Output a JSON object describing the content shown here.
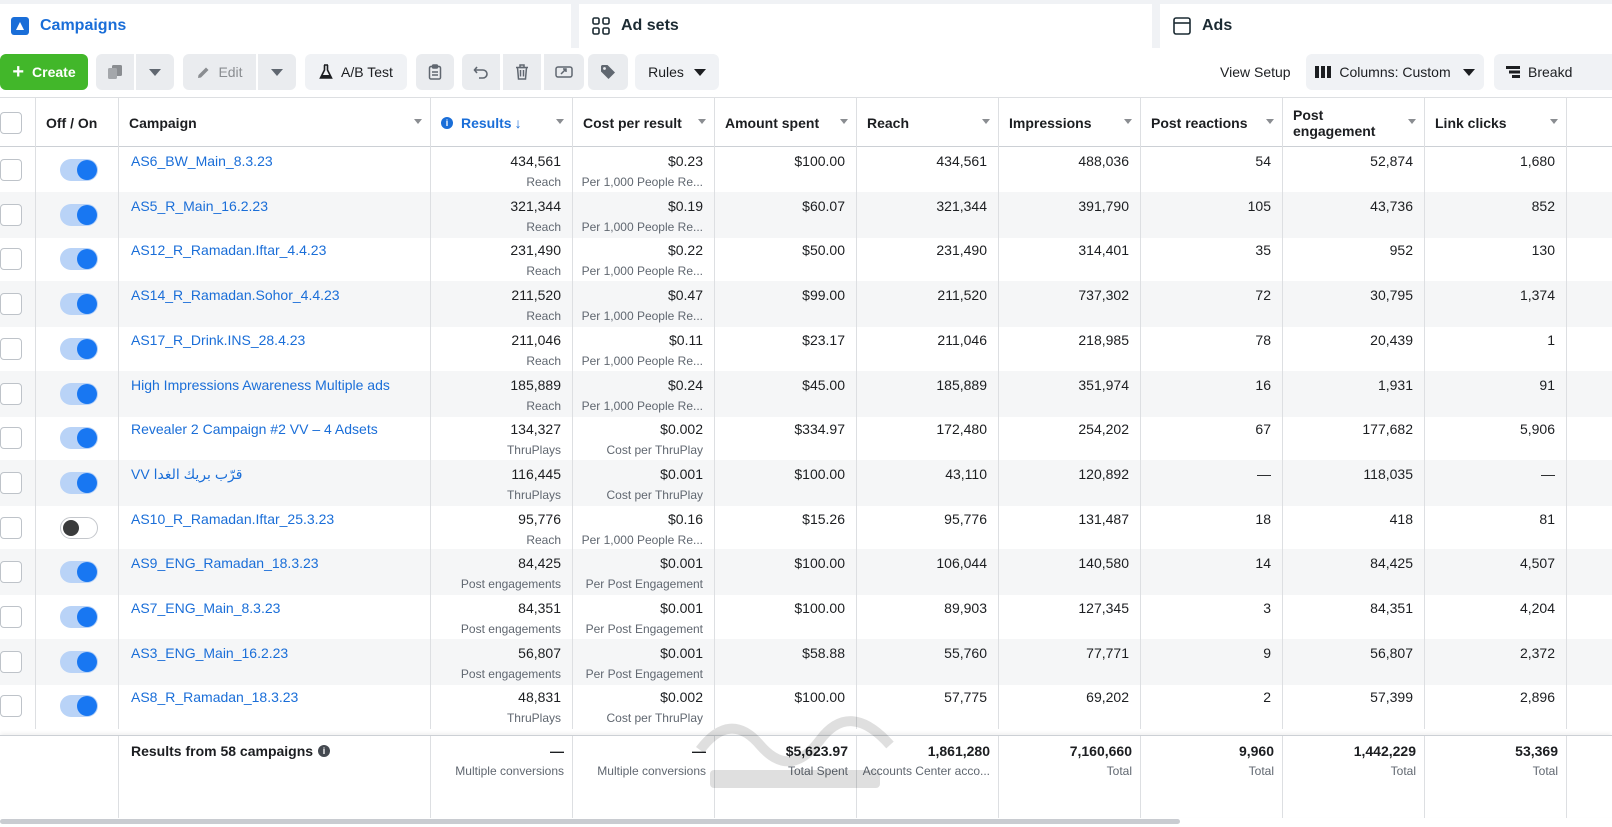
{
  "tabs": [
    {
      "label": "Campaigns",
      "icon": "campaigns-folder-icon"
    },
    {
      "label": "Ad sets",
      "icon": "ad-sets-grid-icon"
    },
    {
      "label": "Ads",
      "icon": "ads-window-icon"
    }
  ],
  "toolbar": {
    "create_label": "Create",
    "edit_label": "Edit",
    "ab_test_label": "A/B Test",
    "rules_label": "Rules",
    "view_setup_label": "View Setup",
    "columns_label": "Columns: Custom",
    "breakdown_label": "Breakd"
  },
  "columns": {
    "off_on": "Off / On",
    "campaign": "Campaign",
    "results": "Results",
    "cost_per_result": "Cost per result",
    "amount_spent": "Amount spent",
    "reach": "Reach",
    "impressions": "Impressions",
    "post_reactions": "Post reactions",
    "post_engagement_1": "Post",
    "post_engagement_2": "engagement",
    "link_clicks": "Link clicks"
  },
  "rows": [
    {
      "on": true,
      "name": "AS6_BW_Main_8.3.23",
      "results": "434,561",
      "results_sub": "Reach",
      "cost": "$0.23",
      "cost_sub": "Per 1,000 People Re...",
      "spent": "$100.00",
      "reach": "434,561",
      "impressions": "488,036",
      "reactions": "54",
      "engagement": "52,874",
      "clicks": "1,680"
    },
    {
      "on": true,
      "name": "AS5_R_Main_16.2.23",
      "results": "321,344",
      "results_sub": "Reach",
      "cost": "$0.19",
      "cost_sub": "Per 1,000 People Re...",
      "spent": "$60.07",
      "reach": "321,344",
      "impressions": "391,790",
      "reactions": "105",
      "engagement": "43,736",
      "clicks": "852"
    },
    {
      "on": true,
      "name": "AS12_R_Ramadan.Iftar_4.4.23",
      "results": "231,490",
      "results_sub": "Reach",
      "cost": "$0.22",
      "cost_sub": "Per 1,000 People Re...",
      "spent": "$50.00",
      "reach": "231,490",
      "impressions": "314,401",
      "reactions": "35",
      "engagement": "952",
      "clicks": "130"
    },
    {
      "on": true,
      "name": "AS14_R_Ramadan.Sohor_4.4.23",
      "results": "211,520",
      "results_sub": "Reach",
      "cost": "$0.47",
      "cost_sub": "Per 1,000 People Re...",
      "spent": "$99.00",
      "reach": "211,520",
      "impressions": "737,302",
      "reactions": "72",
      "engagement": "30,795",
      "clicks": "1,374"
    },
    {
      "on": true,
      "name": "AS17_R_Drink.INS_28.4.23",
      "results": "211,046",
      "results_sub": "Reach",
      "cost": "$0.11",
      "cost_sub": "Per 1,000 People Re...",
      "spent": "$23.17",
      "reach": "211,046",
      "impressions": "218,985",
      "reactions": "78",
      "engagement": "20,439",
      "clicks": "1"
    },
    {
      "on": true,
      "name": "High Impressions Awareness Multiple ads",
      "results": "185,889",
      "results_sub": "Reach",
      "cost": "$0.24",
      "cost_sub": "Per 1,000 People Re...",
      "spent": "$45.00",
      "reach": "185,889",
      "impressions": "351,974",
      "reactions": "16",
      "engagement": "1,931",
      "clicks": "91"
    },
    {
      "on": true,
      "name": "Revealer 2 Campaign #2 VV – 4 Adsets",
      "results": "134,327",
      "results_sub": "ThruPlays",
      "cost": "$0.002",
      "cost_sub": "Cost per ThruPlay",
      "spent": "$334.97",
      "reach": "172,480",
      "impressions": "254,202",
      "reactions": "67",
      "engagement": "177,682",
      "clicks": "5,906"
    },
    {
      "on": true,
      "name": "VV قرّب بريك الغدا",
      "results": "116,445",
      "results_sub": "ThruPlays",
      "cost": "$0.001",
      "cost_sub": "Cost per ThruPlay",
      "spent": "$100.00",
      "reach": "43,110",
      "impressions": "120,892",
      "reactions": "—",
      "engagement": "118,035",
      "clicks": "—"
    },
    {
      "on": false,
      "name": "AS10_R_Ramadan.Iftar_25.3.23",
      "results": "95,776",
      "results_sub": "Reach",
      "cost": "$0.16",
      "cost_sub": "Per 1,000 People Re...",
      "spent": "$15.26",
      "reach": "95,776",
      "impressions": "131,487",
      "reactions": "18",
      "engagement": "418",
      "clicks": "81"
    },
    {
      "on": true,
      "name": "AS9_ENG_Ramadan_18.3.23",
      "results": "84,425",
      "results_sub": "Post engagements",
      "cost": "$0.001",
      "cost_sub": "Per Post Engagement",
      "spent": "$100.00",
      "reach": "106,044",
      "impressions": "140,580",
      "reactions": "14",
      "engagement": "84,425",
      "clicks": "4,507"
    },
    {
      "on": true,
      "name": "AS7_ENG_Main_8.3.23",
      "results": "84,351",
      "results_sub": "Post engagements",
      "cost": "$0.001",
      "cost_sub": "Per Post Engagement",
      "spent": "$100.00",
      "reach": "89,903",
      "impressions": "127,345",
      "reactions": "3",
      "engagement": "84,351",
      "clicks": "4,204"
    },
    {
      "on": true,
      "name": "AS3_ENG_Main_16.2.23",
      "results": "56,807",
      "results_sub": "Post engagements",
      "cost": "$0.001",
      "cost_sub": "Per Post Engagement",
      "spent": "$58.88",
      "reach": "55,760",
      "impressions": "77,771",
      "reactions": "9",
      "engagement": "56,807",
      "clicks": "2,372"
    },
    {
      "on": true,
      "name": "AS8_R_Ramadan_18.3.23",
      "results": "48,831",
      "results_sub": "ThruPlays",
      "cost": "$0.002",
      "cost_sub": "Cost per ThruPlay",
      "spent": "$100.00",
      "reach": "57,775",
      "impressions": "69,202",
      "reactions": "2",
      "engagement": "57,399",
      "clicks": "2,896"
    }
  ],
  "totals": {
    "title": "Results from 58 campaigns",
    "results": "—",
    "results_sub": "Multiple conversions",
    "cost": "—",
    "cost_sub": "Multiple conversions",
    "spent": "$5,623.97",
    "spent_sub": "Total Spent",
    "reach": "1,861,280",
    "reach_sub": "Accounts Center acco...",
    "impressions": "7,160,660",
    "impressions_sub": "Total",
    "reactions": "9,960",
    "reactions_sub": "Total",
    "engagement": "1,442,229",
    "engagement_sub": "Total",
    "clicks": "53,369",
    "clicks_sub": "Total"
  },
  "colors": {
    "accent": "#1a6ed8",
    "create": "#42b72a",
    "toggle_on": "#1877f2"
  }
}
